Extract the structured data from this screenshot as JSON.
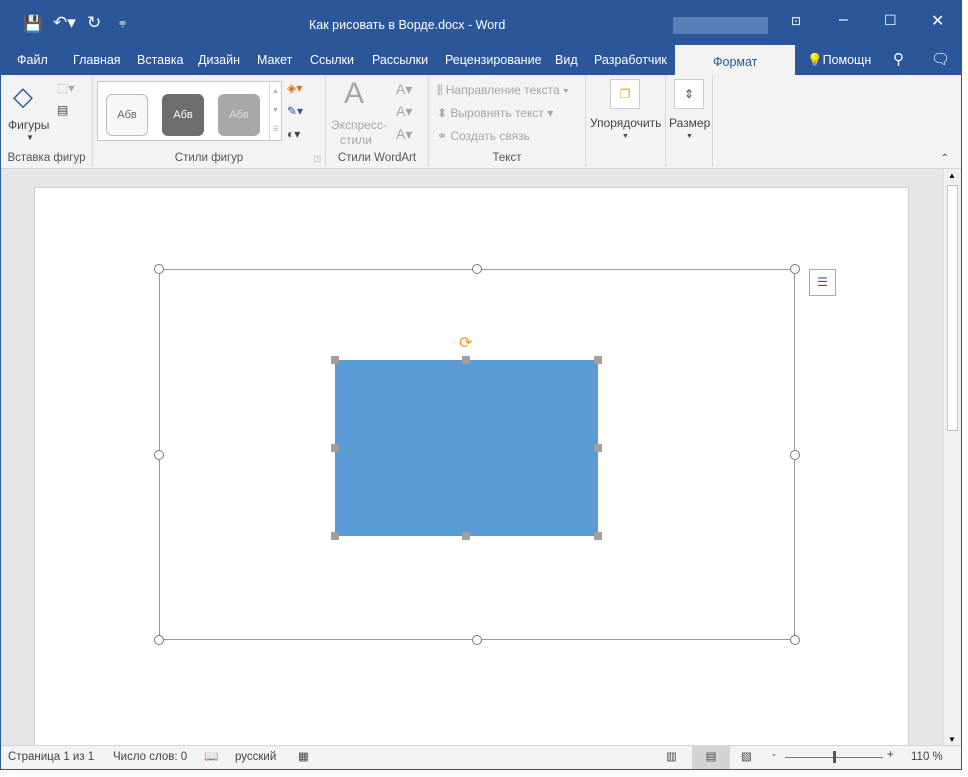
{
  "window": {
    "title": "Как рисовать в Ворде.docx - Word"
  },
  "tabs": [
    {
      "label": "Файл"
    },
    {
      "label": "Главная"
    },
    {
      "label": "Вставка"
    },
    {
      "label": "Дизайн"
    },
    {
      "label": "Макет"
    },
    {
      "label": "Ссылки"
    },
    {
      "label": "Рассылки"
    },
    {
      "label": "Рецензирование"
    },
    {
      "label": "Вид"
    },
    {
      "label": "Разработчик"
    },
    {
      "label": "Формат",
      "active": true
    }
  ],
  "help": "Помощн",
  "ribbon": {
    "insert_shapes": {
      "shapes": "Фигуры",
      "label": "Вставка фигур"
    },
    "shape_styles": {
      "styles": [
        "Абв",
        "Абв",
        "Абв"
      ],
      "label": "Стили фигур"
    },
    "wordart": {
      "express": "Экспресс-",
      "styles": "стили",
      "label": "Стили WordArt"
    },
    "text": {
      "direction": "Направление текста",
      "align": "Выровнять текст",
      "link": "Создать связь",
      "label": "Текст"
    },
    "arrange": "Упорядочить",
    "size": "Размер"
  },
  "shape": {
    "fill": "#5b9bd5"
  },
  "status": {
    "page": "Страница 1 из 1",
    "words": "Число слов: 0",
    "language": "русский",
    "zoom": "110 %"
  },
  "colors": {
    "brand": "#2b579a"
  }
}
